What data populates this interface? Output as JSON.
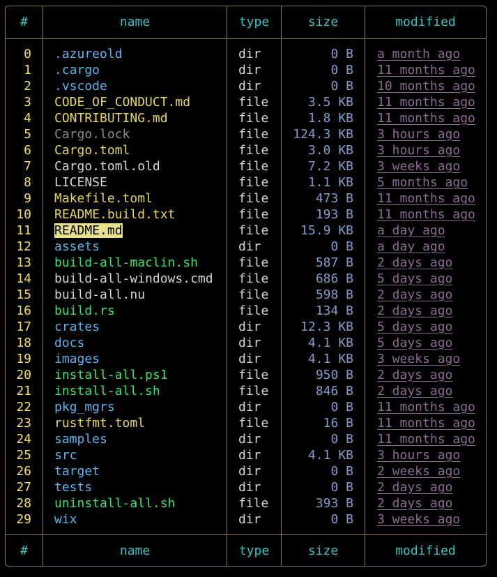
{
  "headers": {
    "index": "#",
    "name": "name",
    "type": "type",
    "size": "size",
    "modified": "modified"
  },
  "colors": {
    "border": "#8a7a3c",
    "header": "#2ec6c6",
    "index": "#f2e05a",
    "dir": "#56b6f0",
    "code": "#e6d75a",
    "exec": "#2ee86a",
    "plain": "#d6d6d6",
    "dim": "#8a8a8a",
    "size": "#7f9ccb",
    "modified": "#8a6a92",
    "highlight_bg": "#e8e08a"
  },
  "rows": [
    {
      "index": "0",
      "name": ".azureold",
      "type": "dir",
      "size": "0 B",
      "modified": "a month ago",
      "kind": "dir"
    },
    {
      "index": "1",
      "name": ".cargo",
      "type": "dir",
      "size": "0 B",
      "modified": "11 months ago",
      "kind": "dir"
    },
    {
      "index": "2",
      "name": ".vscode",
      "type": "dir",
      "size": "0 B",
      "modified": "10 months ago",
      "kind": "dir"
    },
    {
      "index": "3",
      "name": "CODE_OF_CONDUCT.md",
      "type": "file",
      "size": "3.5 KB",
      "modified": "11 months ago",
      "kind": "code"
    },
    {
      "index": "4",
      "name": "CONTRIBUTING.md",
      "type": "file",
      "size": "1.8 KB",
      "modified": "11 months ago",
      "kind": "code"
    },
    {
      "index": "5",
      "name": "Cargo.lock",
      "type": "file",
      "size": "124.3 KB",
      "modified": "3 hours ago",
      "kind": "dim"
    },
    {
      "index": "6",
      "name": "Cargo.toml",
      "type": "file",
      "size": "3.0 KB",
      "modified": "3 hours ago",
      "kind": "code"
    },
    {
      "index": "7",
      "name": "Cargo.toml.old",
      "type": "file",
      "size": "7.2 KB",
      "modified": "3 weeks ago",
      "kind": "plain"
    },
    {
      "index": "8",
      "name": "LICENSE",
      "type": "file",
      "size": "1.1 KB",
      "modified": "5 months ago",
      "kind": "plain"
    },
    {
      "index": "9",
      "name": "Makefile.toml",
      "type": "file",
      "size": "473 B",
      "modified": "11 months ago",
      "kind": "code"
    },
    {
      "index": "10",
      "name": "README.build.txt",
      "type": "file",
      "size": "193 B",
      "modified": "11 months ago",
      "kind": "code"
    },
    {
      "index": "11",
      "name": "README.md",
      "type": "file",
      "size": "15.9 KB",
      "modified": "a day ago",
      "kind": "highlight"
    },
    {
      "index": "12",
      "name": "assets",
      "type": "dir",
      "size": "0 B",
      "modified": "a day ago",
      "kind": "dir"
    },
    {
      "index": "13",
      "name": "build-all-maclin.sh",
      "type": "file",
      "size": "587 B",
      "modified": "2 days ago",
      "kind": "exec"
    },
    {
      "index": "14",
      "name": "build-all-windows.cmd",
      "type": "file",
      "size": "686 B",
      "modified": "5 days ago",
      "kind": "plain"
    },
    {
      "index": "15",
      "name": "build-all.nu",
      "type": "file",
      "size": "598 B",
      "modified": "2 days ago",
      "kind": "plain"
    },
    {
      "index": "16",
      "name": "build.rs",
      "type": "file",
      "size": "134 B",
      "modified": "2 days ago",
      "kind": "exec"
    },
    {
      "index": "17",
      "name": "crates",
      "type": "dir",
      "size": "12.3 KB",
      "modified": "5 days ago",
      "kind": "dir"
    },
    {
      "index": "18",
      "name": "docs",
      "type": "dir",
      "size": "4.1 KB",
      "modified": "5 days ago",
      "kind": "dir"
    },
    {
      "index": "19",
      "name": "images",
      "type": "dir",
      "size": "4.1 KB",
      "modified": "3 weeks ago",
      "kind": "dir"
    },
    {
      "index": "20",
      "name": "install-all.ps1",
      "type": "file",
      "size": "950 B",
      "modified": "2 days ago",
      "kind": "exec"
    },
    {
      "index": "21",
      "name": "install-all.sh",
      "type": "file",
      "size": "846 B",
      "modified": "2 days ago",
      "kind": "exec"
    },
    {
      "index": "22",
      "name": "pkg_mgrs",
      "type": "dir",
      "size": "0 B",
      "modified": "11 months ago",
      "kind": "dir"
    },
    {
      "index": "23",
      "name": "rustfmt.toml",
      "type": "file",
      "size": "16 B",
      "modified": "11 months ago",
      "kind": "code"
    },
    {
      "index": "24",
      "name": "samples",
      "type": "dir",
      "size": "0 B",
      "modified": "11 months ago",
      "kind": "dir"
    },
    {
      "index": "25",
      "name": "src",
      "type": "dir",
      "size": "4.1 KB",
      "modified": "3 hours ago",
      "kind": "dir"
    },
    {
      "index": "26",
      "name": "target",
      "type": "dir",
      "size": "0 B",
      "modified": "2 weeks ago",
      "kind": "dir"
    },
    {
      "index": "27",
      "name": "tests",
      "type": "dir",
      "size": "0 B",
      "modified": "2 days ago",
      "kind": "dir"
    },
    {
      "index": "28",
      "name": "uninstall-all.sh",
      "type": "file",
      "size": "393 B",
      "modified": "2 days ago",
      "kind": "exec"
    },
    {
      "index": "29",
      "name": "wix",
      "type": "dir",
      "size": "0 B",
      "modified": "3 weeks ago",
      "kind": "dir"
    }
  ]
}
